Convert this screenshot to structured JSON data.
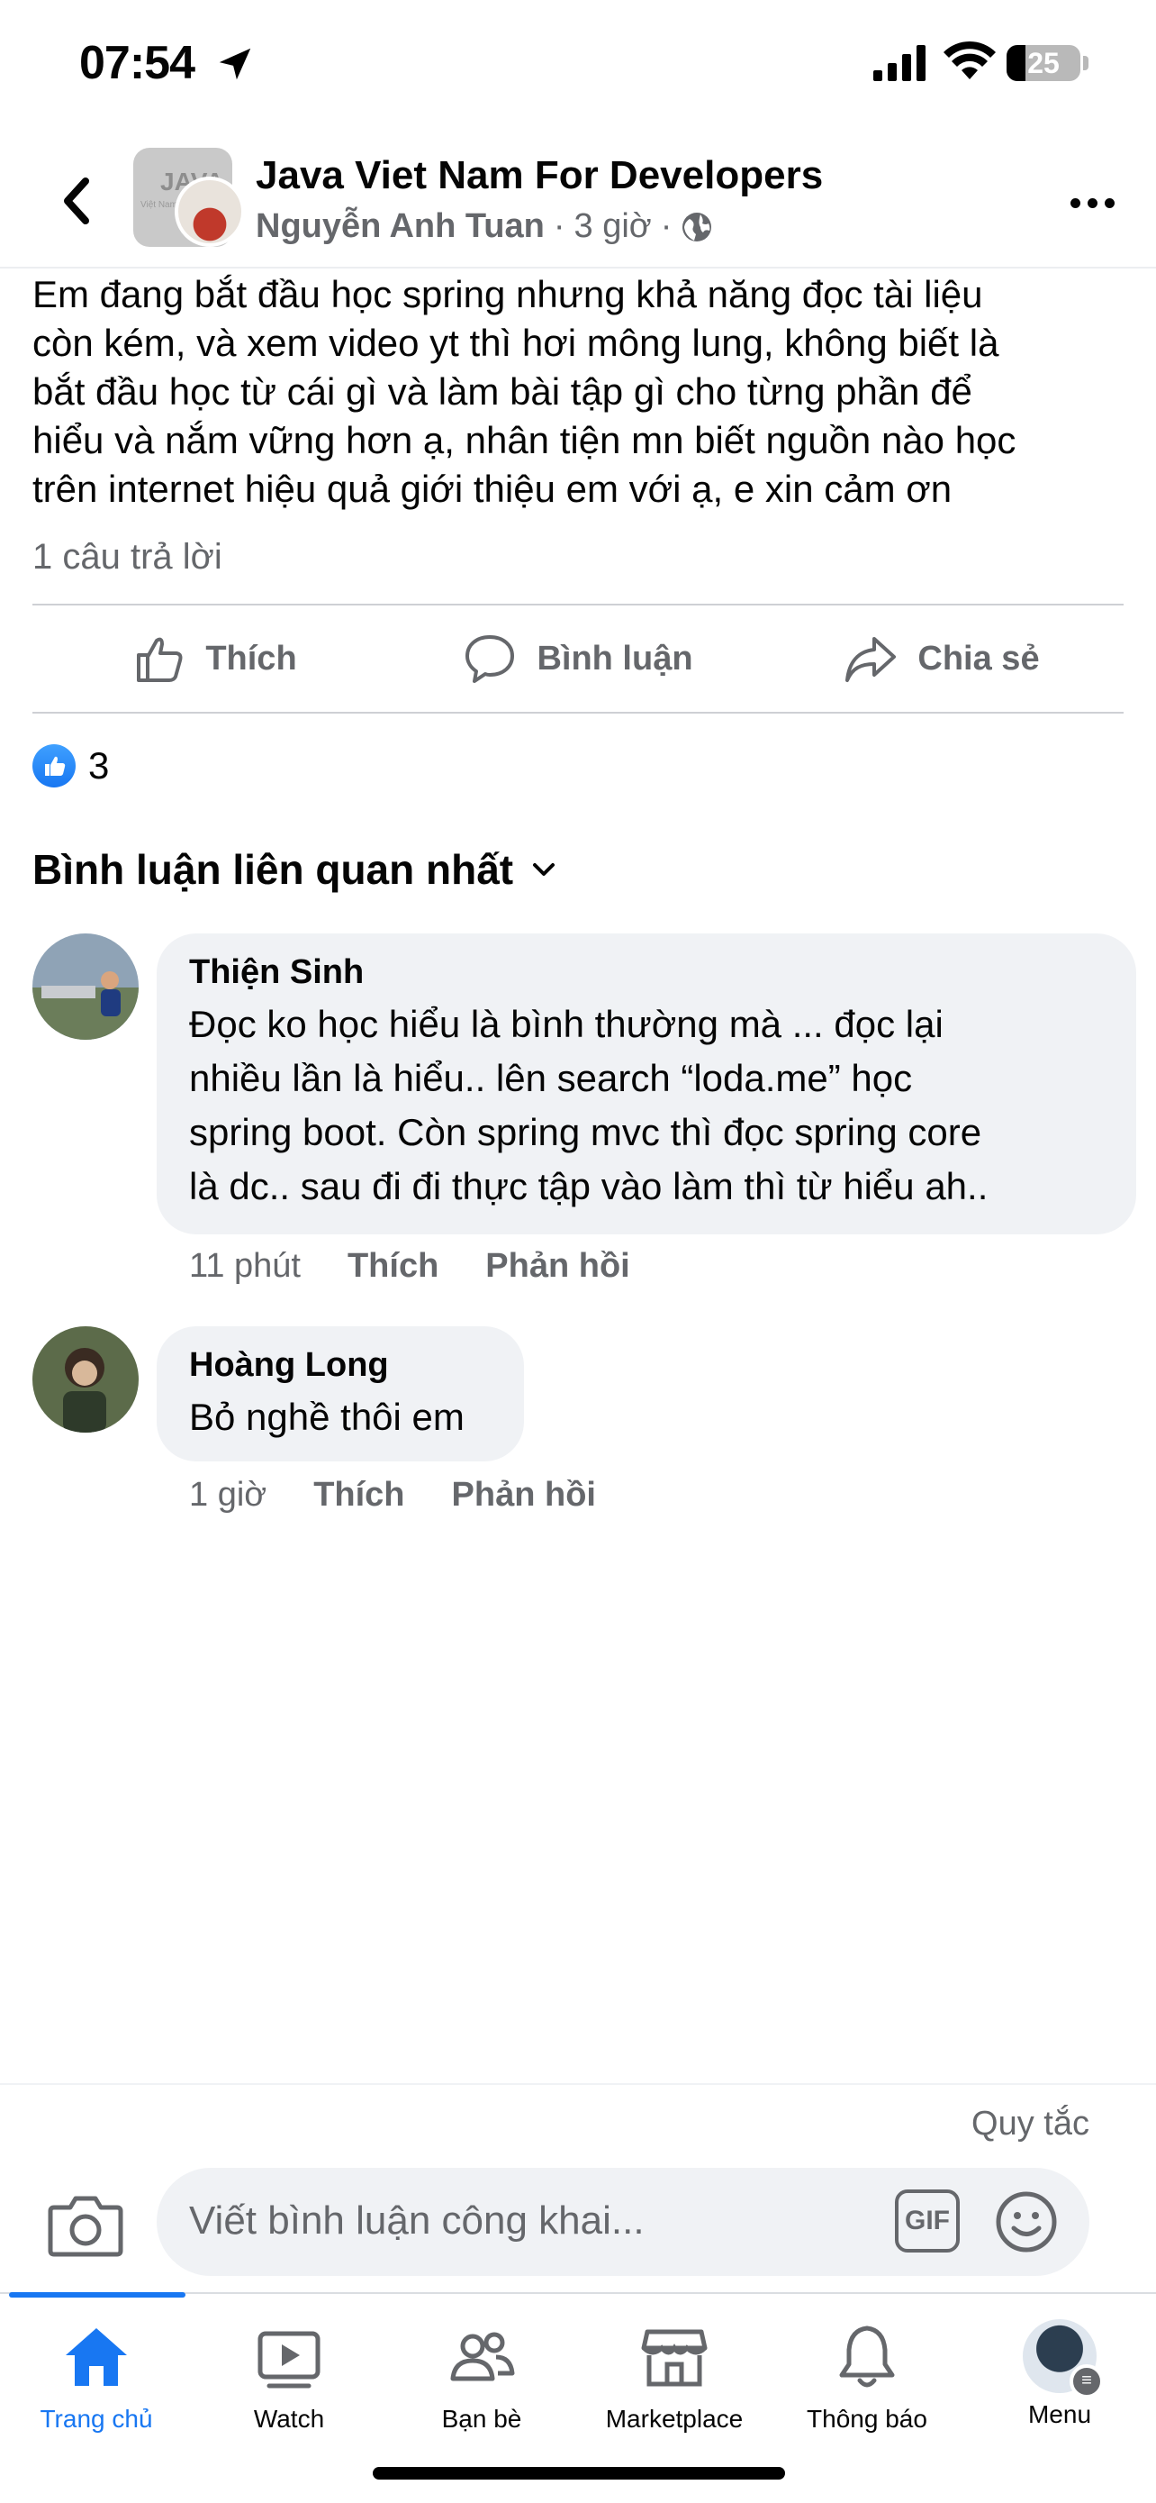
{
  "status_bar": {
    "time": "07:54",
    "battery": "25",
    "battery_level": 0.25
  },
  "header": {
    "group_name": "Java Viet Nam For Developers",
    "group_avatar_text": "JAVA",
    "group_avatar_subtext": "Việt Nam",
    "author": "Nguyễn Anh Tuan",
    "time": "3 giờ",
    "separator": "·",
    "icons": {
      "back": "chevron-left-icon",
      "more": "more-dots-icon",
      "privacy": "globe-icon"
    }
  },
  "post": {
    "lines": [
      "Em đang bắt đầu học spring nhưng khả năng đọc tài liệu",
      "còn kém, và xem video yt thì hơi mông lung, không biết là",
      "bắt đầu học từ cái  gì và làm bài tập gì cho từng phần để",
      "hiểu và nắm vững hơn ạ, nhân tiện mn biết nguồn nào học",
      "trên internet hiệu quả giới thiệu em với ạ, e xin cảm ơn"
    ],
    "reply_count": "1 câu trả lời"
  },
  "actions": {
    "like": "Thích",
    "comment": "Bình luận",
    "share": "Chia sẻ"
  },
  "reactions": {
    "count": "3"
  },
  "sort": {
    "label": "Bình luận liên quan nhất"
  },
  "comments": [
    {
      "name": "Thiện Sinh",
      "lines": [
        "Đọc ko học hiểu là bình thường mà ... đọc lại",
        "nhiều lần là hiểu..  lên search “loda.me” học",
        "spring boot. Còn spring mvc thì đọc spring core",
        "là dc.. sau đi đi thực tập vào làm thì từ hiểu ah.."
      ],
      "time": "11 phút",
      "like": "Thích",
      "reply": "Phản hồi"
    },
    {
      "name": "Hoàng Long",
      "lines": [
        "Bỏ nghề thôi em"
      ],
      "time": "1 giờ",
      "like": "Thích",
      "reply": "Phản hồi"
    }
  ],
  "composer": {
    "rules": "Quy tắc",
    "placeholder": "Viết bình luận công khai...",
    "gif": "GIF"
  },
  "tabs": [
    {
      "label": "Trang chủ",
      "icon": "home-icon",
      "active": true
    },
    {
      "label": "Watch",
      "icon": "watch-icon",
      "active": false
    },
    {
      "label": "Bạn bè",
      "icon": "friends-icon",
      "active": false
    },
    {
      "label": "Marketplace",
      "icon": "marketplace-icon",
      "active": false
    },
    {
      "label": "Thông báo",
      "icon": "bell-icon",
      "active": false
    },
    {
      "label": "Menu",
      "icon": "menu-avatar",
      "active": false
    }
  ],
  "colors": {
    "accent": "#1877f2",
    "secondary_text": "#65676b",
    "bubble": "#f0f2f5"
  }
}
